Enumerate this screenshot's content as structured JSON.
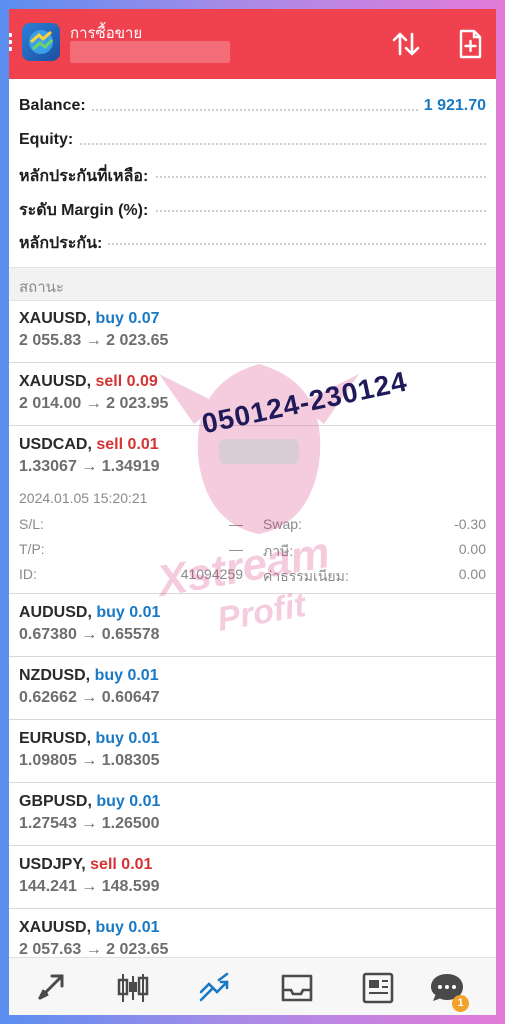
{
  "header": {
    "title": "การซื้อขาย",
    "colors": {
      "bar": "#f0414f"
    },
    "icons": [
      "menu-icon",
      "app-logo",
      "sort-icon",
      "new-order-icon"
    ]
  },
  "summary": {
    "balance_label": "Balance:",
    "balance_value": "1 921.70",
    "equity_label": "Equity:",
    "free_margin_label": "หลักประกันที่เหลือ:",
    "margin_level_label": "ระดับ Margin (%):",
    "margin_label": "หลักประกัน:"
  },
  "status_section": {
    "label": "สถานะ"
  },
  "orders": [
    {
      "symbol": "XAUUSD,",
      "side": "buy 0.07",
      "prices": "2 055.83 → 2 023.65"
    },
    {
      "symbol": "XAUUSD,",
      "side": "sell 0.09",
      "prices": "2 014.00 → 2 023.95"
    },
    {
      "symbol": "USDCAD,",
      "side": "sell 0.01",
      "prices": "1.33067 → 1.34919",
      "time": "2024.01.05 15:20:21",
      "details": {
        "sl_label": "S/L:",
        "sl_value": "—",
        "swap_label": "Swap:",
        "swap_value": "-0.30",
        "tp_label": "T/P:",
        "tp_value": "—",
        "tax_label": "ภาษี:",
        "tax_value": "0.00",
        "id_label": "ID:",
        "id_value": "41094259",
        "commission_label": "ค่าธรรมเนียม:",
        "commission_value": "0.00"
      }
    },
    {
      "symbol": "AUDUSD,",
      "side": "buy 0.01",
      "prices": "0.67380 → 0.65578"
    },
    {
      "symbol": "NZDUSD,",
      "side": "buy 0.01",
      "prices": "0.62662 → 0.60647"
    },
    {
      "symbol": "EURUSD,",
      "side": "buy 0.01",
      "prices": "1.09805 → 1.08305"
    },
    {
      "symbol": "GBPUSD,",
      "side": "buy 0.01",
      "prices": "1.27543 → 1.26500"
    },
    {
      "symbol": "USDJPY,",
      "side": "sell 0.01",
      "prices": "144.241 → 148.599"
    },
    {
      "symbol": "XAUUSD,",
      "side": "buy 0.01",
      "prices": "2 057.63 → 2 023.65"
    }
  ],
  "overlay": {
    "stamp_text": "050124-230124",
    "watermark_text_1": "Xstream",
    "watermark_text_2": "Profit"
  },
  "tabbar": {
    "icons": [
      "quotes-icon",
      "chart-icon",
      "trade-icon",
      "history-icon",
      "news-icon",
      "chat-icon"
    ],
    "active": "trade-icon",
    "chat_badge": "1",
    "colors": {
      "active": "#1a79c4",
      "inactive": "#4a4a4a",
      "badge": "#f2a12a"
    }
  },
  "colors": {
    "buy": "#1a79c4",
    "sell": "#d43333",
    "balance": "#1a79c4"
  }
}
